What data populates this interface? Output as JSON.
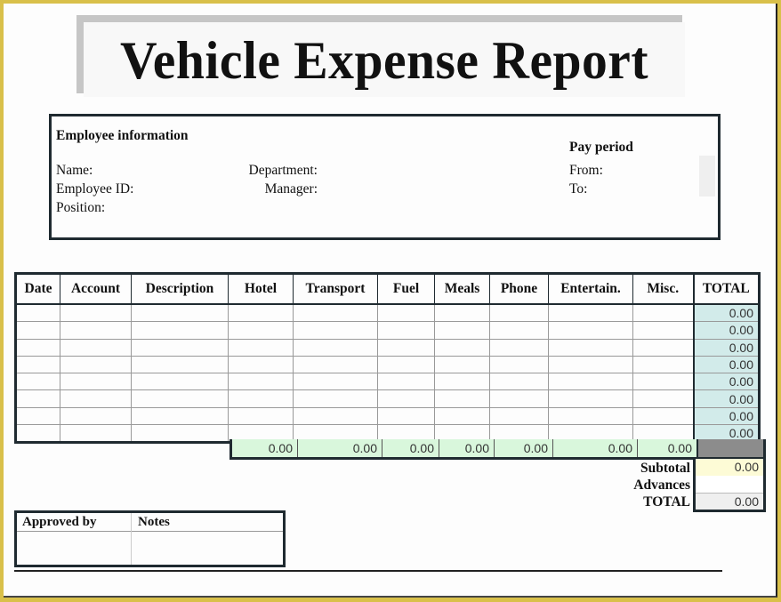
{
  "title": "Vehicle Expense Report",
  "employee_info": {
    "heading": "Employee information",
    "name_label": "Name:",
    "employee_id_label": "Employee ID:",
    "position_label": "Position:",
    "department_label": "Department:",
    "manager_label": "Manager:"
  },
  "pay_period": {
    "heading": "Pay period",
    "from_label": "From:",
    "to_label": "To:"
  },
  "expense_table": {
    "columns": [
      "Date",
      "Account",
      "Description",
      "Hotel",
      "Transport",
      "Fuel",
      "Meals",
      "Phone",
      "Entertain.",
      "Misc.",
      "TOTAL"
    ],
    "rows": [
      {
        "total": "0.00"
      },
      {
        "total": "0.00"
      },
      {
        "total": "0.00"
      },
      {
        "total": "0.00"
      },
      {
        "total": "0.00"
      },
      {
        "total": "0.00"
      },
      {
        "total": "0.00"
      },
      {
        "total": "0.00"
      }
    ],
    "column_totals": [
      "0.00",
      "0.00",
      "0.00",
      "0.00",
      "0.00",
      "0.00",
      "0.00"
    ]
  },
  "summary": {
    "subtotal_label": "Subtotal",
    "subtotal_value": "0.00",
    "advances_label": "Advances",
    "advances_value": "",
    "total_label": "TOTAL",
    "total_value": "0.00"
  },
  "approval": {
    "approved_by_label": "Approved by",
    "notes_label": "Notes"
  }
}
